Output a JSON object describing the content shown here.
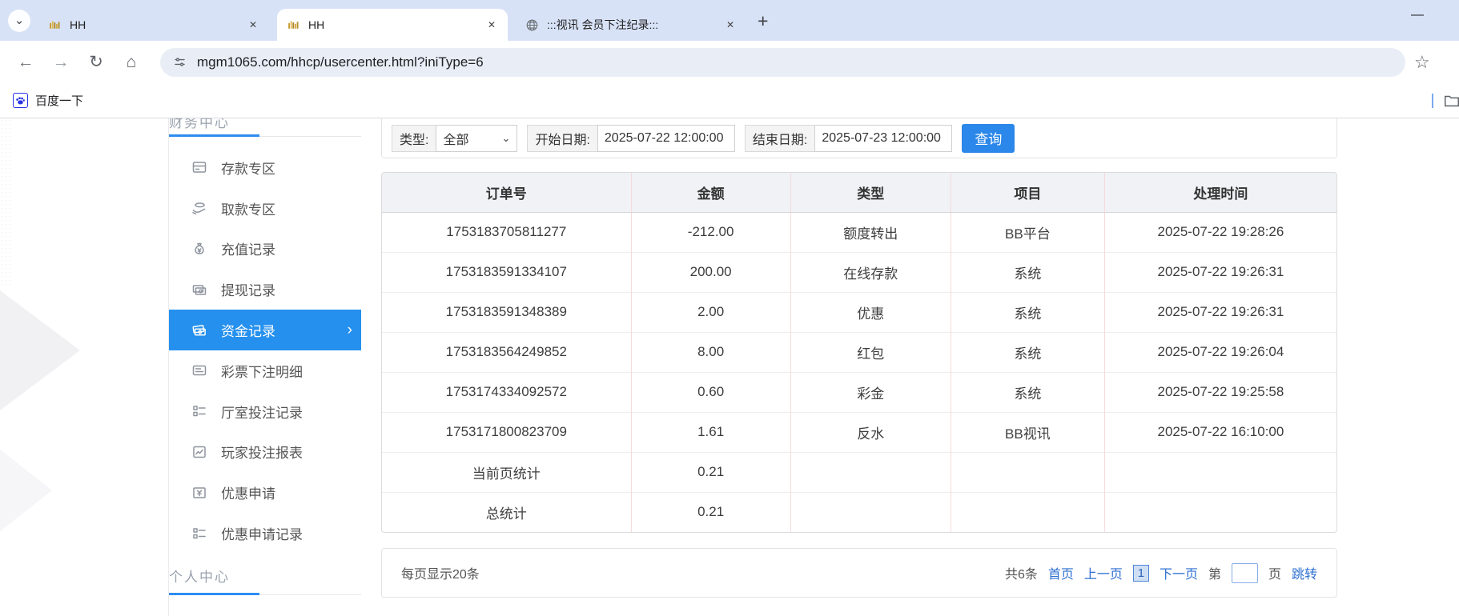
{
  "browser": {
    "window_controls": {
      "minimize": "—"
    },
    "icons": {
      "tab_search": "⌄",
      "close": "✕",
      "new_tab": "+",
      "back": "←",
      "forward": "→",
      "reload": "↻",
      "home": "⌂",
      "star": "☆",
      "select_caret": "⌄",
      "chevron_right": "›"
    },
    "tabs": [
      {
        "title": "HH",
        "icon": "gold-bars-favicon",
        "active": false
      },
      {
        "title": "HH",
        "icon": "gold-bars-favicon",
        "active": true
      },
      {
        "title": ":::视讯 会员下注纪录:::",
        "icon": "globe-favicon",
        "active": false
      }
    ],
    "url": "mgm1065.com/hhcp/usercenter.html?iniType=6",
    "bookmarks": [
      {
        "label": "百度一下"
      }
    ]
  },
  "sidebar": {
    "section_top": "财务中心",
    "section_bottom": "个人中心",
    "items": [
      {
        "label": "存款专区",
        "icon": "deposit-card-icon",
        "active": false
      },
      {
        "label": "取款专区",
        "icon": "withdraw-hand-icon",
        "active": false
      },
      {
        "label": "充值记录",
        "icon": "recharge-moneybag-icon",
        "active": false
      },
      {
        "label": "提现记录",
        "icon": "withdraw-record-icon",
        "active": false
      },
      {
        "label": "资金记录",
        "icon": "funds-record-icon",
        "active": true
      },
      {
        "label": "彩票下注明细",
        "icon": "lottery-detail-icon",
        "active": false
      },
      {
        "label": "厅室投注记录",
        "icon": "hall-bet-list-icon",
        "active": false
      },
      {
        "label": "玩家投注报表",
        "icon": "player-report-icon",
        "active": false
      },
      {
        "label": "优惠申请",
        "icon": "promo-apply-icon",
        "active": false
      },
      {
        "label": "优惠申请记录",
        "icon": "promo-record-icon",
        "active": false
      }
    ]
  },
  "filters": {
    "type_label": "类型:",
    "type_value": "全部",
    "start_label": "开始日期:",
    "start_value": "2025-07-22 12:00:00",
    "end_label": "结束日期:",
    "end_value": "2025-07-23 12:00:00",
    "search_button": "查询"
  },
  "table": {
    "columns": [
      "订单号",
      "金额",
      "类型",
      "项目",
      "处理时间"
    ],
    "rows": [
      [
        "1753183705811277",
        "-212.00",
        "额度转出",
        "BB平台",
        "2025-07-22 19:28:26"
      ],
      [
        "1753183591334107",
        "200.00",
        "在线存款",
        "系统",
        "2025-07-22 19:26:31"
      ],
      [
        "1753183591348389",
        "2.00",
        "优惠",
        "系统",
        "2025-07-22 19:26:31"
      ],
      [
        "1753183564249852",
        "8.00",
        "红包",
        "系统",
        "2025-07-22 19:26:04"
      ],
      [
        "1753174334092572",
        "0.60",
        "彩金",
        "系统",
        "2025-07-22 19:25:58"
      ],
      [
        "1753171800823709",
        "1.61",
        "反水",
        "BB视讯",
        "2025-07-22 16:10:00"
      ],
      [
        "当前页统计",
        "0.21",
        "",
        "",
        ""
      ],
      [
        "总统计",
        "0.21",
        "",
        "",
        ""
      ]
    ]
  },
  "pagination": {
    "page_size_text": "每页显示20条",
    "total_text": "共6条",
    "first": "首页",
    "prev": "上一页",
    "current_page": "1",
    "next": "下一页",
    "jump_prefix": "第",
    "jump_suffix": "页",
    "jump_button": "跳转"
  },
  "colors": {
    "accent_blue": "#2590ee",
    "button_blue": "#2b87e9",
    "link_blue": "#2d6fd0",
    "table_header_bg": "#f0f2f5",
    "cell_border_pink": "#f6dbdb",
    "tabstrip_bg": "#d8e2f7"
  }
}
